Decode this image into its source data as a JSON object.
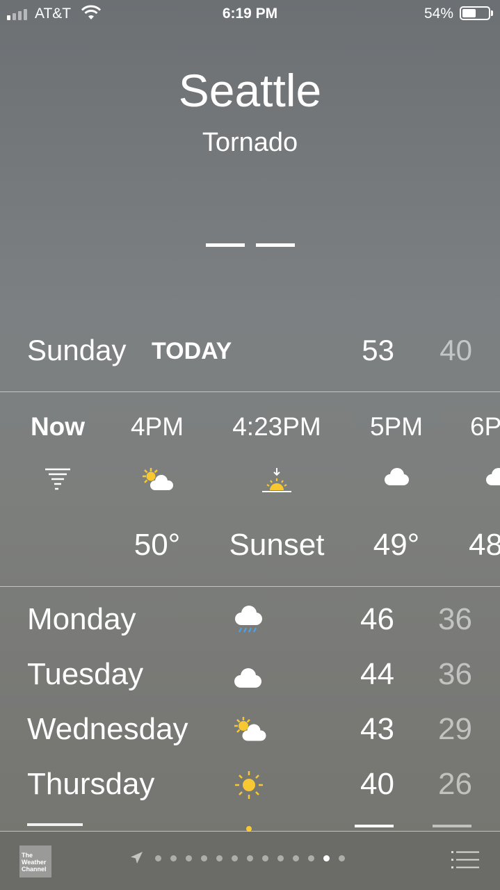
{
  "status_bar": {
    "carrier": "AT&T",
    "time": "6:19 PM",
    "battery_percent_label": "54%",
    "battery_level": 0.54
  },
  "header": {
    "city": "Seattle",
    "condition": "Tornado",
    "temperature": "— —"
  },
  "today": {
    "day": "Sunday",
    "tag": "TODAY",
    "high": "53",
    "low": "40"
  },
  "hourly": [
    {
      "label": "Now",
      "icon": "tornado-icon",
      "value": ""
    },
    {
      "label": "4PM",
      "icon": "partly-sunny-icon",
      "value": "50°"
    },
    {
      "label": "4:23PM",
      "icon": "sunset-icon",
      "value": "Sunset"
    },
    {
      "label": "5PM",
      "icon": "cloud-icon",
      "value": "49°"
    },
    {
      "label": "6P",
      "icon": "cloud-icon",
      "value": "48"
    }
  ],
  "daily": [
    {
      "day": "Monday",
      "icon": "rain-icon",
      "high": "46",
      "low": "36"
    },
    {
      "day": "Tuesday",
      "icon": "cloud-icon",
      "high": "44",
      "low": "36"
    },
    {
      "day": "Wednesday",
      "icon": "partly-sunny-icon",
      "high": "43",
      "low": "29"
    },
    {
      "day": "Thursday",
      "icon": "sun-icon",
      "high": "40",
      "low": "26"
    }
  ],
  "bottom_bar": {
    "logo_text": "The Weather Channel",
    "page_count": 13,
    "active_page": 11
  },
  "colors": {
    "sun": "#f7c831",
    "rain": "#4aa3ea"
  }
}
